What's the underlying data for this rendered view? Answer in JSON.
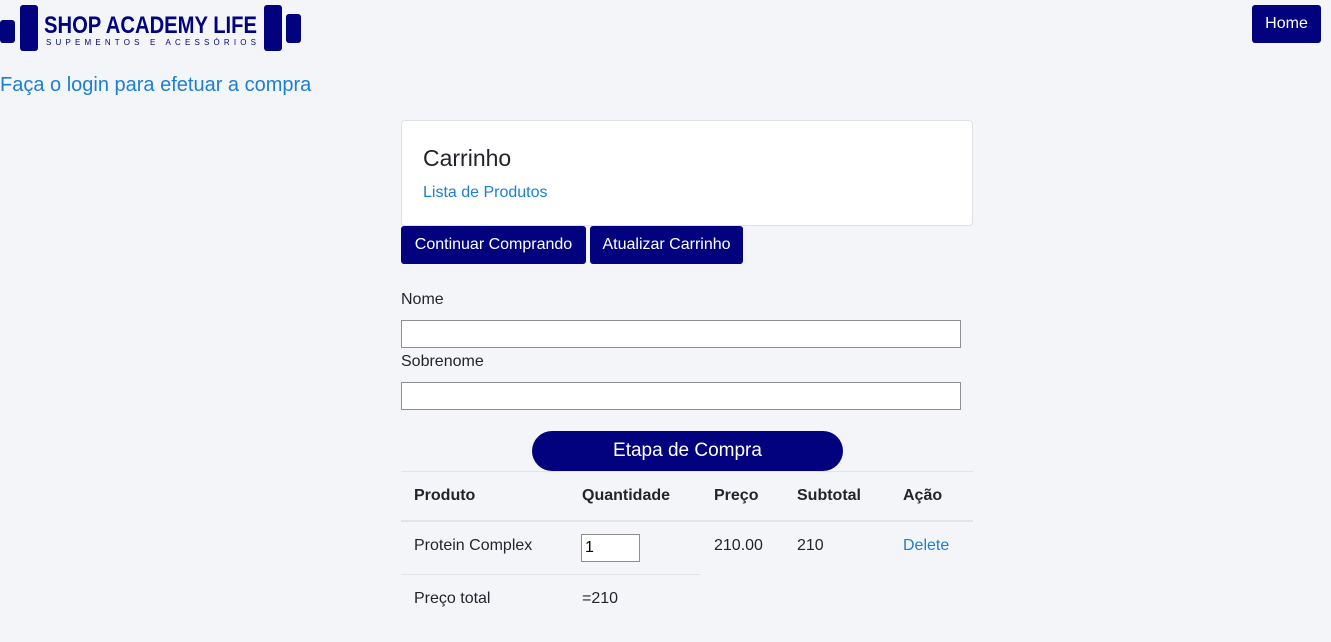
{
  "header": {
    "logo_title": "SHOP ACADEMY LIFE",
    "logo_subtitle": "SUPEMENTOS E ACESSÓRIOS",
    "home_label": "Home"
  },
  "login_prompt": "Faça o login para efetuar a compra",
  "card": {
    "title": "Carrinho",
    "link": "Lista de Produtos"
  },
  "actions": {
    "continue_label": "Continuar Comprando",
    "update_label": "Atualizar Carrinho"
  },
  "form": {
    "nome_label": "Nome",
    "nome_value": "",
    "sobrenome_label": "Sobrenome",
    "sobrenome_value": "",
    "submit_label": "Etapa de Compra"
  },
  "table": {
    "headers": [
      "Produto",
      "Quantidade",
      "Preço",
      "Subtotal",
      "Ação"
    ],
    "rows": [
      {
        "produto": "Protein Complex",
        "quantidade": "1",
        "preco": "210.00",
        "subtotal": "210",
        "acao": "Delete"
      }
    ],
    "total_label": "Preço total",
    "total_value": "=210"
  },
  "colors": {
    "primary": "#02027f",
    "link": "#1b7fd4",
    "background": "#f4f5f9"
  }
}
